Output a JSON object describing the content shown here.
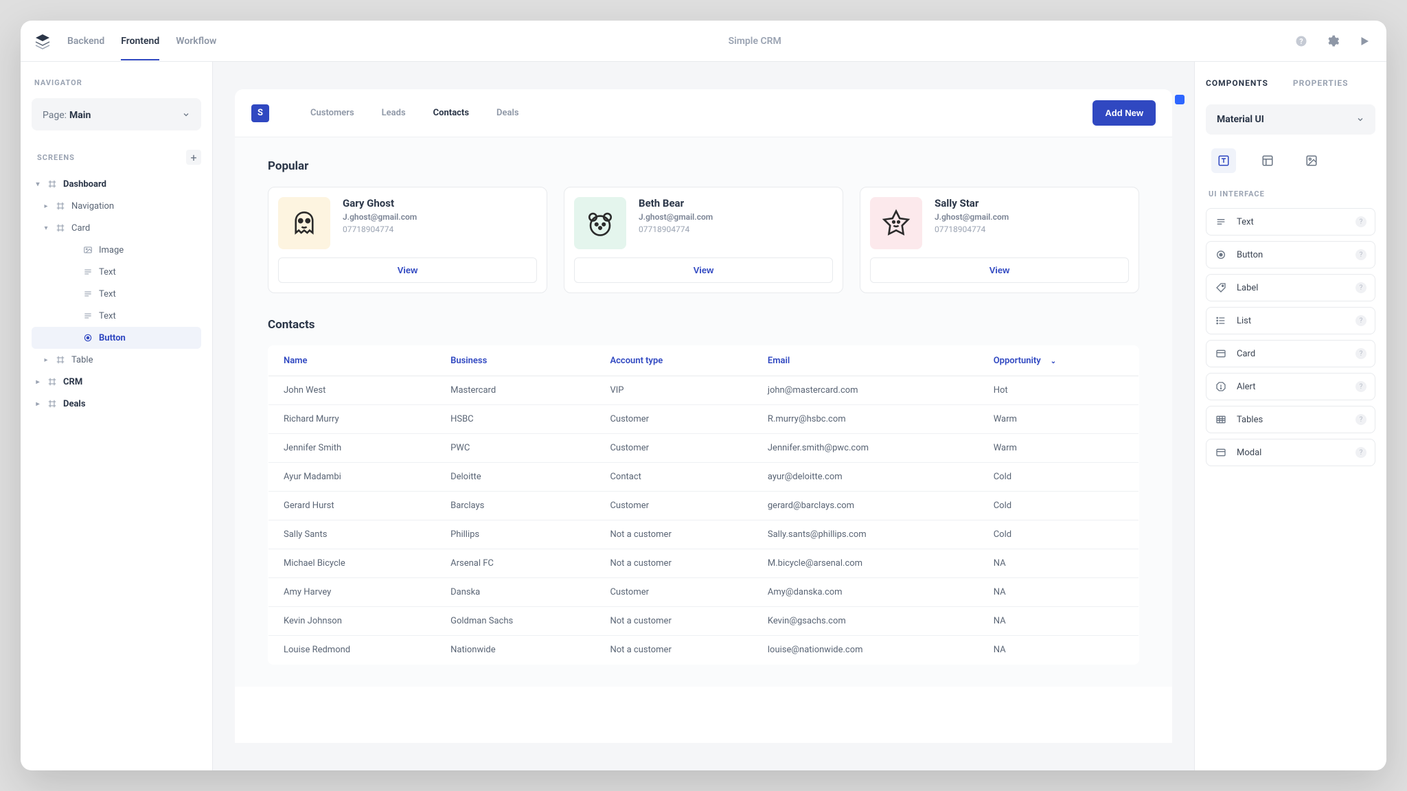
{
  "top": {
    "tabs": [
      "Backend",
      "Frontend",
      "Workflow"
    ],
    "active_tab": "Frontend",
    "title": "Simple CRM"
  },
  "navigator": {
    "label": "NAVIGATOR",
    "page_prefix": "Page:",
    "page_name": "Main",
    "screens_label": "SCREENS",
    "tree": [
      {
        "label": "Dashboard",
        "icon": "frame",
        "indent": 0,
        "caret": "down",
        "bold": true
      },
      {
        "label": "Navigation",
        "icon": "frame",
        "indent": 1,
        "caret": "right"
      },
      {
        "label": "Card",
        "icon": "frame",
        "indent": 1,
        "caret": "down"
      },
      {
        "label": "Image",
        "icon": "image",
        "indent": 3
      },
      {
        "label": "Text",
        "icon": "text",
        "indent": 3
      },
      {
        "label": "Text",
        "icon": "text",
        "indent": 3
      },
      {
        "label": "Text",
        "icon": "text",
        "indent": 3
      },
      {
        "label": "Button",
        "icon": "radio",
        "indent": 3,
        "selected": true
      },
      {
        "label": "Table",
        "icon": "frame",
        "indent": 1,
        "caret": "right"
      },
      {
        "label": "CRM",
        "icon": "frame",
        "indent": 0,
        "caret": "right",
        "bold": true
      },
      {
        "label": "Deals",
        "icon": "frame",
        "indent": 0,
        "caret": "right",
        "bold": true
      }
    ]
  },
  "preview": {
    "brand_letter": "S",
    "tabs": [
      "Customers",
      "Leads",
      "Contacts",
      "Deals"
    ],
    "active_tab": "Contacts",
    "add_new": "Add New",
    "popular_title": "Popular",
    "cards": [
      {
        "name": "Gary Ghost",
        "email": "J.ghost@gmail.com",
        "phone": "07718904774",
        "color": "yellow",
        "icon": "ghost"
      },
      {
        "name": "Beth Bear",
        "email": "J.ghost@gmail.com",
        "phone": "07718904774",
        "color": "green",
        "icon": "bear"
      },
      {
        "name": "Sally Star",
        "email": "J.ghost@gmail.com",
        "phone": "07718904774",
        "color": "pink",
        "icon": "star"
      }
    ],
    "view_label": "View",
    "contacts_title": "Contacts",
    "table": {
      "headers": [
        "Name",
        "Business",
        "Account type",
        "Email",
        "Opportunity"
      ],
      "rows": [
        [
          "John West",
          "Mastercard",
          "VIP",
          "john@mastercard.com",
          "Hot"
        ],
        [
          "Richard Murry",
          "HSBC",
          "Customer",
          "R.murry@hsbc.com",
          "Warm"
        ],
        [
          "Jennifer Smith",
          "PWC",
          "Customer",
          "Jennifer.smith@pwc.com",
          "Warm"
        ],
        [
          "Ayur Madambi",
          "Deloitte",
          "Contact",
          "ayur@deloitte.com",
          "Cold"
        ],
        [
          "Gerard Hurst",
          "Barclays",
          "Customer",
          "gerard@barclays.com",
          "Cold"
        ],
        [
          "Sally Sants",
          "Phillips",
          "Not a customer",
          "Sally.sants@phillips.com",
          "Cold"
        ],
        [
          "Michael Bicycle",
          "Arsenal FC",
          "Not a customer",
          "M.bicycle@arsenal.com",
          "NA"
        ],
        [
          "Amy Harvey",
          "Danska",
          "Customer",
          "Amy@danska.com",
          "NA"
        ],
        [
          "Kevin Johnson",
          "Goldman Sachs",
          "Not a customer",
          "Kevin@gsachs.com",
          "NA"
        ],
        [
          "Louise Redmond",
          "Nationwide",
          "Not a customer",
          "louise@nationwide.com",
          "NA"
        ]
      ]
    }
  },
  "components": {
    "tabs": [
      "COMPONENTS",
      "PROPERTIES"
    ],
    "active_tab": "COMPONENTS",
    "library": "Material UI",
    "ui_label": "UI INTERFACE",
    "items": [
      {
        "label": "Text",
        "icon": "text-lines"
      },
      {
        "label": "Button",
        "icon": "radio"
      },
      {
        "label": "Label",
        "icon": "tag"
      },
      {
        "label": "List",
        "icon": "list"
      },
      {
        "label": "Card",
        "icon": "card"
      },
      {
        "label": "Alert",
        "icon": "alert"
      },
      {
        "label": "Tables",
        "icon": "table"
      },
      {
        "label": "Modal",
        "icon": "modal"
      }
    ]
  }
}
